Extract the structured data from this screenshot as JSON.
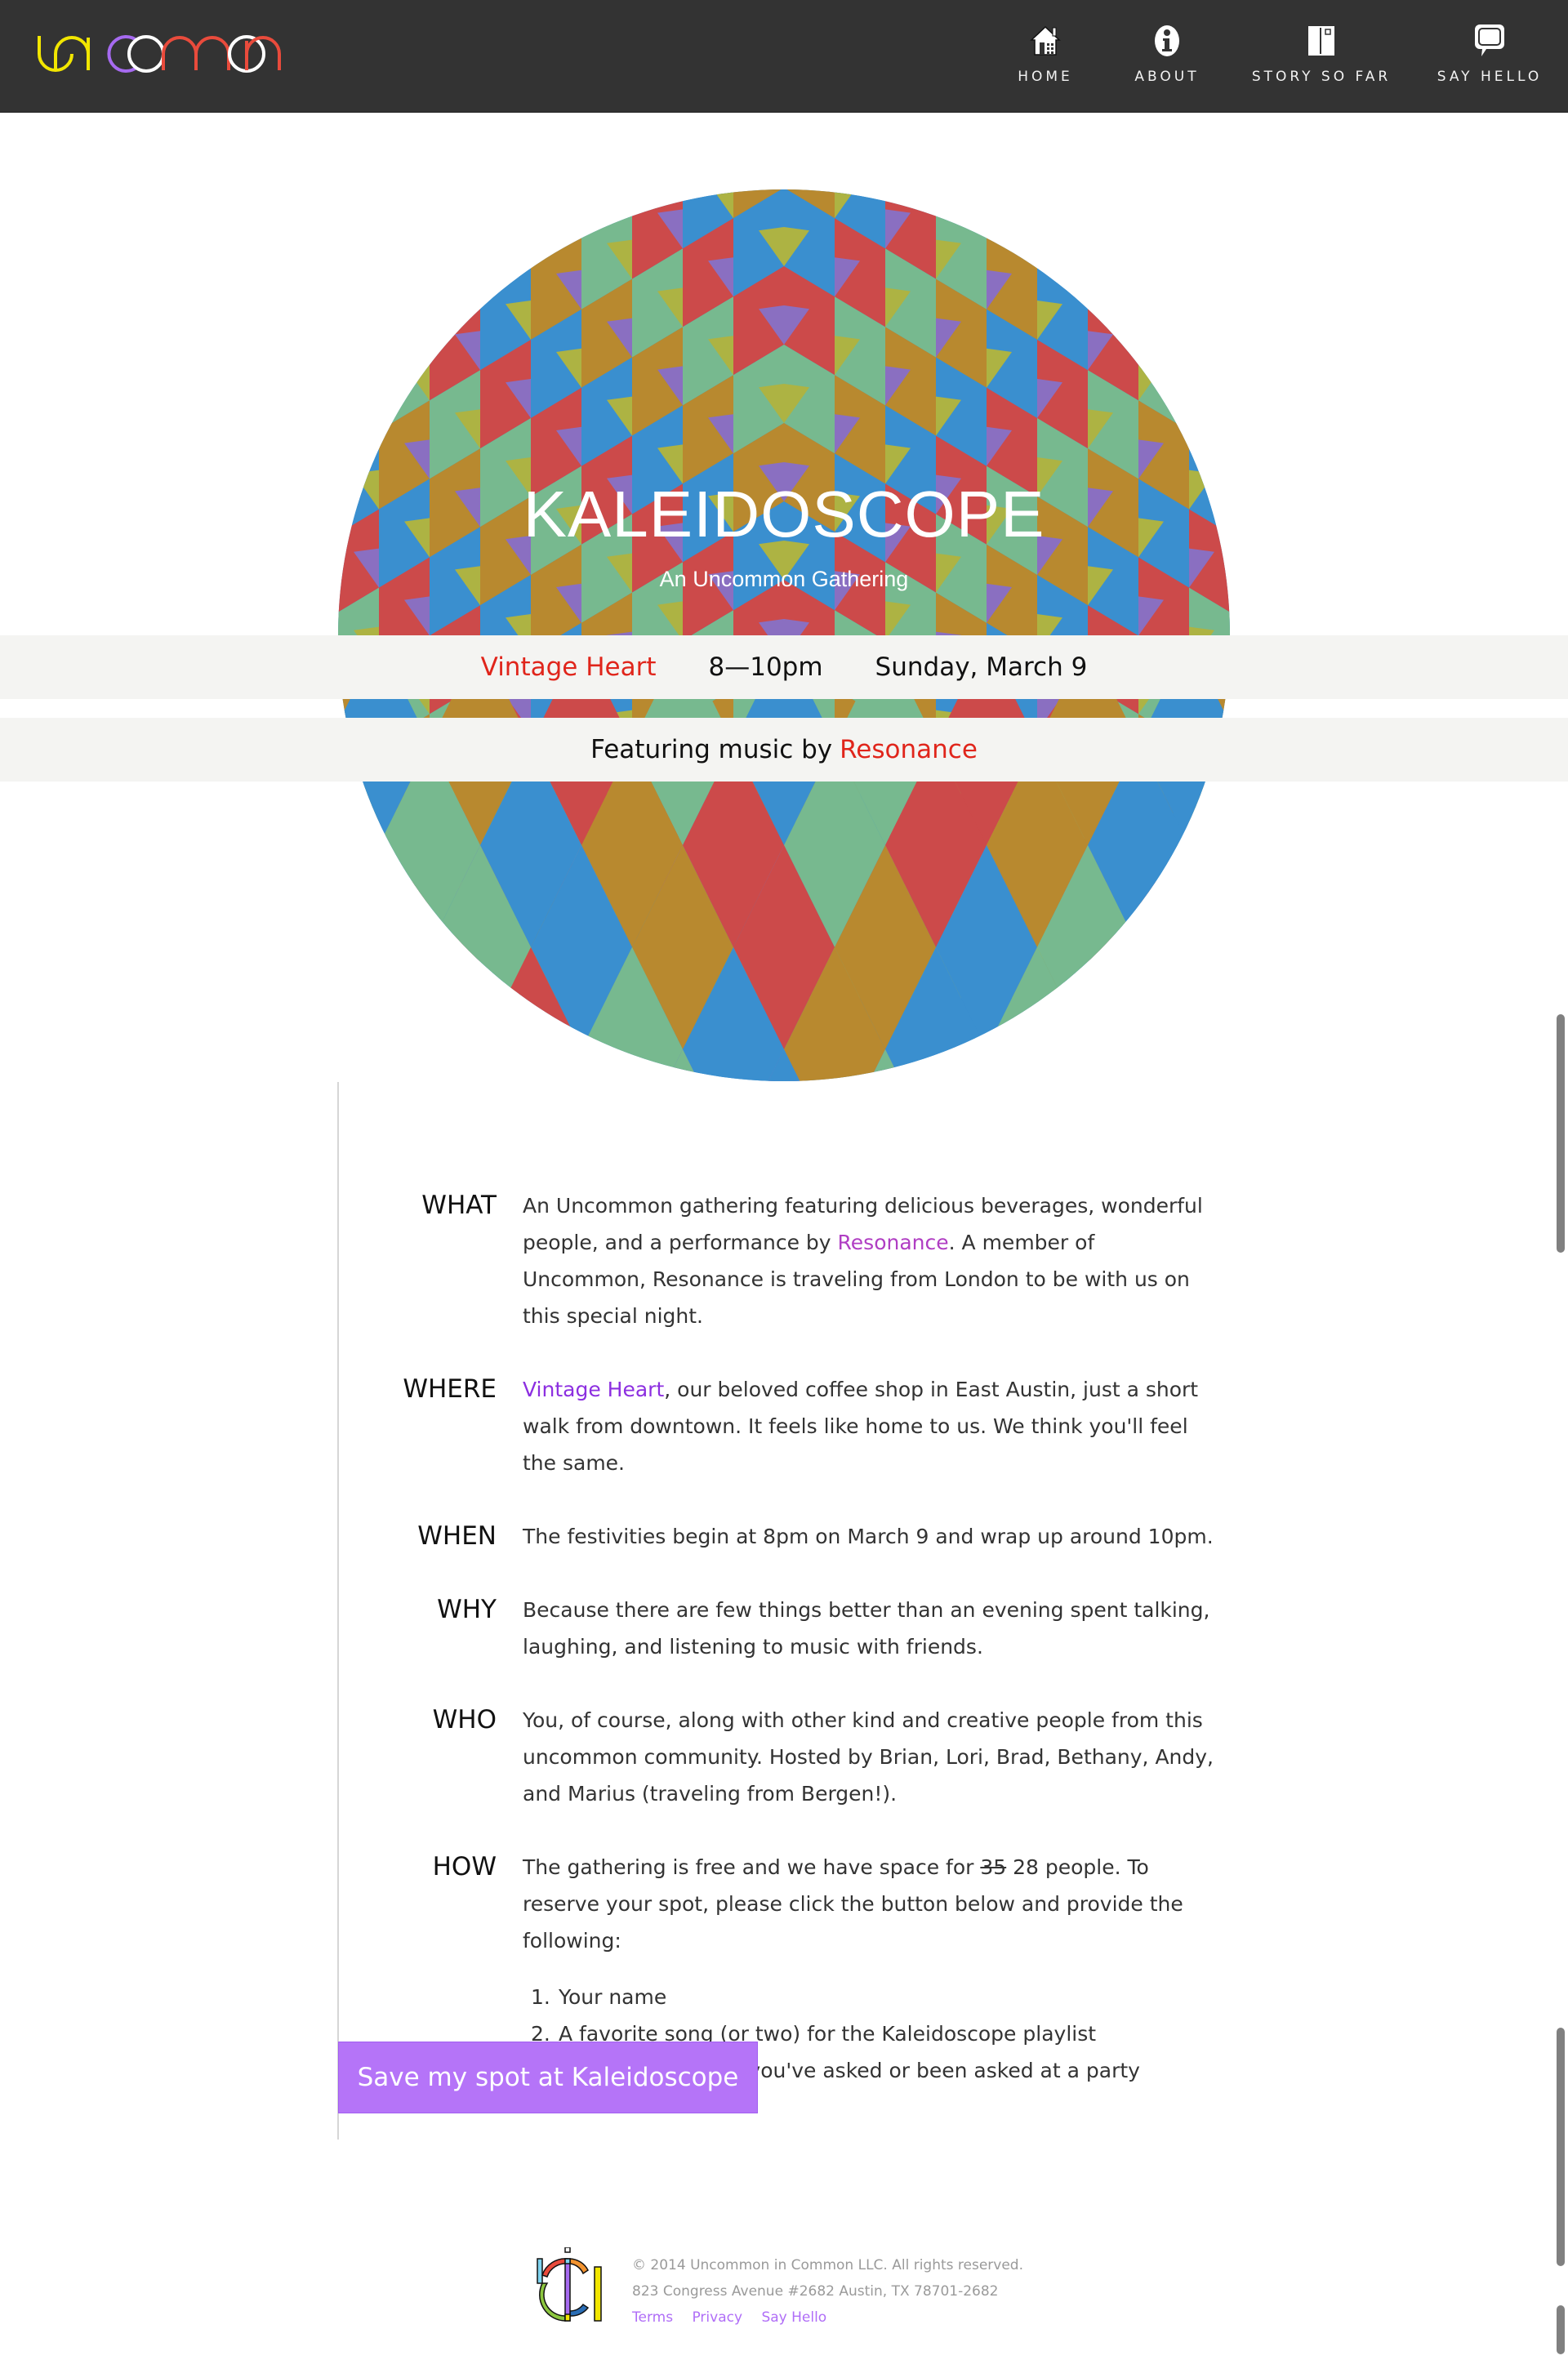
{
  "header": {
    "logo_alt": "uncommon",
    "logo_colors": {
      "u": "#f2e600",
      "n": "#f2e600",
      "c": "#a66af0",
      "o": "#ffffff",
      "m": "#e94b3c",
      "i": "#ffffff"
    },
    "nav": [
      {
        "label": "HOME",
        "icon": "home-icon"
      },
      {
        "label": "ABOUT",
        "icon": "info-icon"
      },
      {
        "label": "STORY SO FAR",
        "icon": "book-icon"
      },
      {
        "label": "SAY HELLO",
        "icon": "speech-bubble-icon"
      }
    ]
  },
  "hero": {
    "title": "KALEIDOSCOPE",
    "subtitle": "An Uncommon Gathering",
    "venue": "Vintage Heart",
    "time": "8—10pm",
    "date": "Sunday, March 9",
    "featuring_prefix": "Featuring music by",
    "artist": "Resonance",
    "palette": [
      "#3a8fcf",
      "#cc4a4a",
      "#77b98f",
      "#b8892f",
      "#adb343",
      "#8a6fc1"
    ]
  },
  "details": [
    {
      "label": "WHAT",
      "parts": [
        {
          "text": "An Uncommon gathering featuring delicious beverages, wonderful people, and a performance by "
        },
        {
          "text": "Resonance",
          "link": true,
          "style": "purple"
        },
        {
          "text": ". A member of Uncommon, Resonance is traveling from London to be with us on this special night."
        }
      ]
    },
    {
      "label": "WHERE",
      "parts": [
        {
          "text": "Vintage Heart",
          "link": true,
          "style": "violet"
        },
        {
          "text": ", our beloved coffee shop in East Austin, just a short walk from downtown. It feels like home to us. We think you'll feel the same."
        }
      ]
    },
    {
      "label": "WHEN",
      "parts": [
        {
          "text": "The festivities begin at 8pm on March 9 and wrap up around 10pm."
        }
      ]
    },
    {
      "label": "WHY",
      "parts": [
        {
          "text": "Because there are few things better than an evening spent talking, laughing, and listening to music with friends."
        }
      ]
    },
    {
      "label": "WHO",
      "parts": [
        {
          "text": "You, of course, along with other kind and creative people from this uncommon community. Hosted by Brian, Lori, Brad, Bethany, Andy, and Marius (traveling from Bergen!)."
        }
      ]
    },
    {
      "label": "HOW",
      "parts": [
        {
          "text": "The gathering is free and we have space for "
        },
        {
          "text": "35",
          "style": "strike"
        },
        {
          "text": " 28 people. To reserve your spot, please click the button below and provide the following:"
        }
      ],
      "steps": [
        "Your name",
        "A favorite song (or two) for the Kaleidoscope playlist",
        "The best question you've asked or been asked at a party"
      ]
    }
  ],
  "cta": {
    "label": "Save my spot at Kaleidoscope",
    "color": "#b574f8"
  },
  "footer": {
    "copyright": "© 2014 Uncommon in Common LLC. All rights reserved.",
    "address": "823 Congress Avenue #2682 Austin, TX 78701-2682",
    "links": [
      "Terms",
      "Privacy",
      "Say Hello"
    ],
    "link_color": "#b06ef7"
  }
}
